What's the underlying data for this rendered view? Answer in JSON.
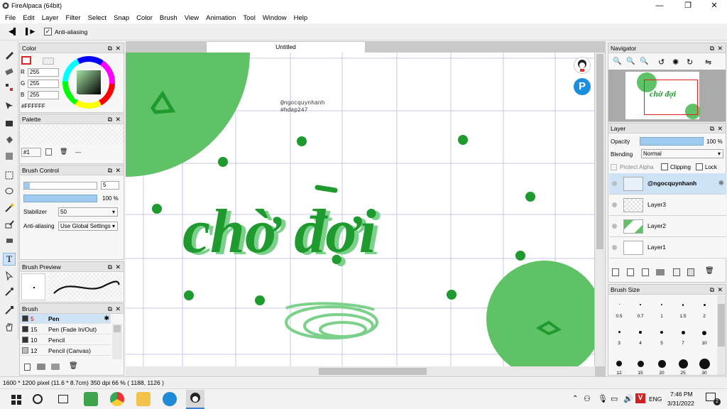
{
  "app": {
    "title": "FireAlpaca (64bit)"
  },
  "menu": [
    "File",
    "Edit",
    "Layer",
    "Filter",
    "Select",
    "Snap",
    "Color",
    "Brush",
    "View",
    "Animation",
    "Tool",
    "Window",
    "Help"
  ],
  "options": {
    "antialiasing_label": "Anti-aliasing",
    "antialiasing_checked": true
  },
  "document": {
    "tab_label": "Untitled"
  },
  "canvas": {
    "watermark_line1": "@ngocquynhanh",
    "watermark_line2": "#hdap247",
    "artwork_text": "chờ đợi",
    "accent_color": "#1e9a2e",
    "circle_color": "#5fc267"
  },
  "color_panel": {
    "title": "Color",
    "r_label": "R",
    "g_label": "G",
    "b_label": "B",
    "r": "255",
    "g": "255",
    "b": "255",
    "hex": "#FFFFFF"
  },
  "palette_panel": {
    "title": "Palette",
    "set_label": "#1",
    "dash": "---"
  },
  "brush_control": {
    "title": "Brush Control",
    "size": "5",
    "opacity": "100 %",
    "stabilizer_label": "Stabilizer",
    "stabilizer_value": "50",
    "antialias_label": "Anti-aliasing",
    "antialias_value": "Use Global Settings"
  },
  "brush_preview": {
    "title": "Brush Preview"
  },
  "brush_panel": {
    "title": "Brush",
    "items": [
      {
        "size": "5",
        "name": "Pen"
      },
      {
        "size": "15",
        "name": "Pen (Fade In/Out)"
      },
      {
        "size": "10",
        "name": "Pencil"
      },
      {
        "size": "12",
        "name": "Pencil (Canvas)"
      }
    ]
  },
  "navigator": {
    "title": "Navigator"
  },
  "layer_panel": {
    "title": "Layer",
    "opacity_label": "Opacity",
    "opacity_value": "100 %",
    "blending_label": "Blending",
    "blending_value": "Normal",
    "protect_alpha": "Protect Alpha",
    "clipping": "Clipping",
    "lock": "Lock",
    "layers": [
      {
        "name": "@ngocquynhanh"
      },
      {
        "name": "Layer3"
      },
      {
        "name": "Layer2"
      },
      {
        "name": "Layer1"
      }
    ]
  },
  "brush_size": {
    "title": "Brush Size",
    "sizes": [
      "0.5",
      "0.7",
      "1",
      "1.5",
      "2",
      "3",
      "4",
      "5",
      "7",
      "10",
      "12",
      "15",
      "20",
      "25",
      "30"
    ]
  },
  "status": {
    "size_text": "1600 * 1200 pixel",
    "cm_text": "(11.6 * 8.7cm)",
    "dpi_text": "350 dpi",
    "zoom_text": "66 %",
    "coord_text": "( 1188, 1126 )"
  },
  "taskbar": {
    "lang": "ENG",
    "time": "7:46 PM",
    "date": "3/31/2022",
    "notify": "2"
  }
}
